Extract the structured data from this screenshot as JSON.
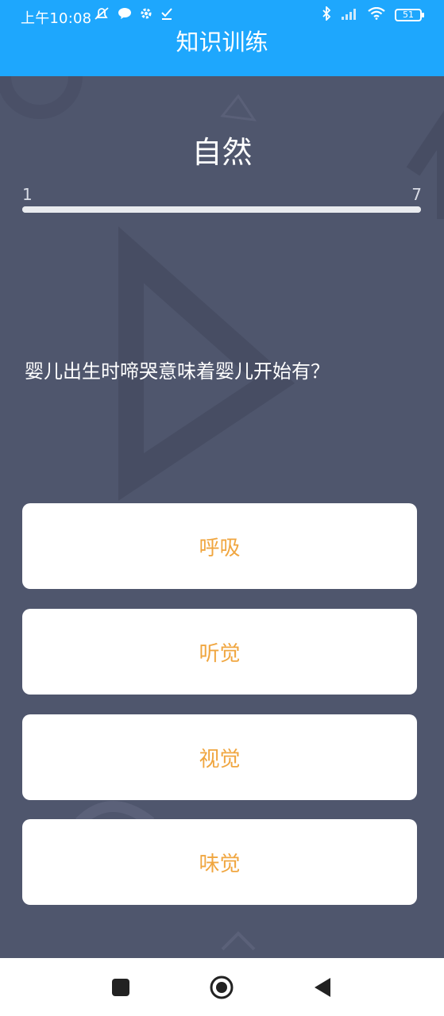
{
  "status_bar": {
    "time": "上午10:08",
    "battery": "51",
    "left_icons": [
      "mute-alarm-icon",
      "chat-bubble-icon",
      "gear-icon",
      "check-download-icon"
    ],
    "right_icons": [
      "bluetooth-icon",
      "signal-icon",
      "wifi-icon",
      "battery-icon"
    ]
  },
  "header": {
    "title": "知识训练"
  },
  "quiz": {
    "category": "自然",
    "progress_start": "1",
    "progress_end": "7",
    "progress_fraction": 1.0,
    "question": "婴儿出生时啼哭意味着婴儿开始有？",
    "options": [
      "呼吸",
      "听觉",
      "视觉",
      "味觉"
    ]
  },
  "colors": {
    "header_bg": "#1ea7fd",
    "content_bg": "#4f566d",
    "option_text": "#f0a640",
    "option_bg": "#ffffff"
  },
  "nav": {
    "buttons": [
      "recent-apps-icon",
      "home-icon",
      "back-icon"
    ]
  }
}
